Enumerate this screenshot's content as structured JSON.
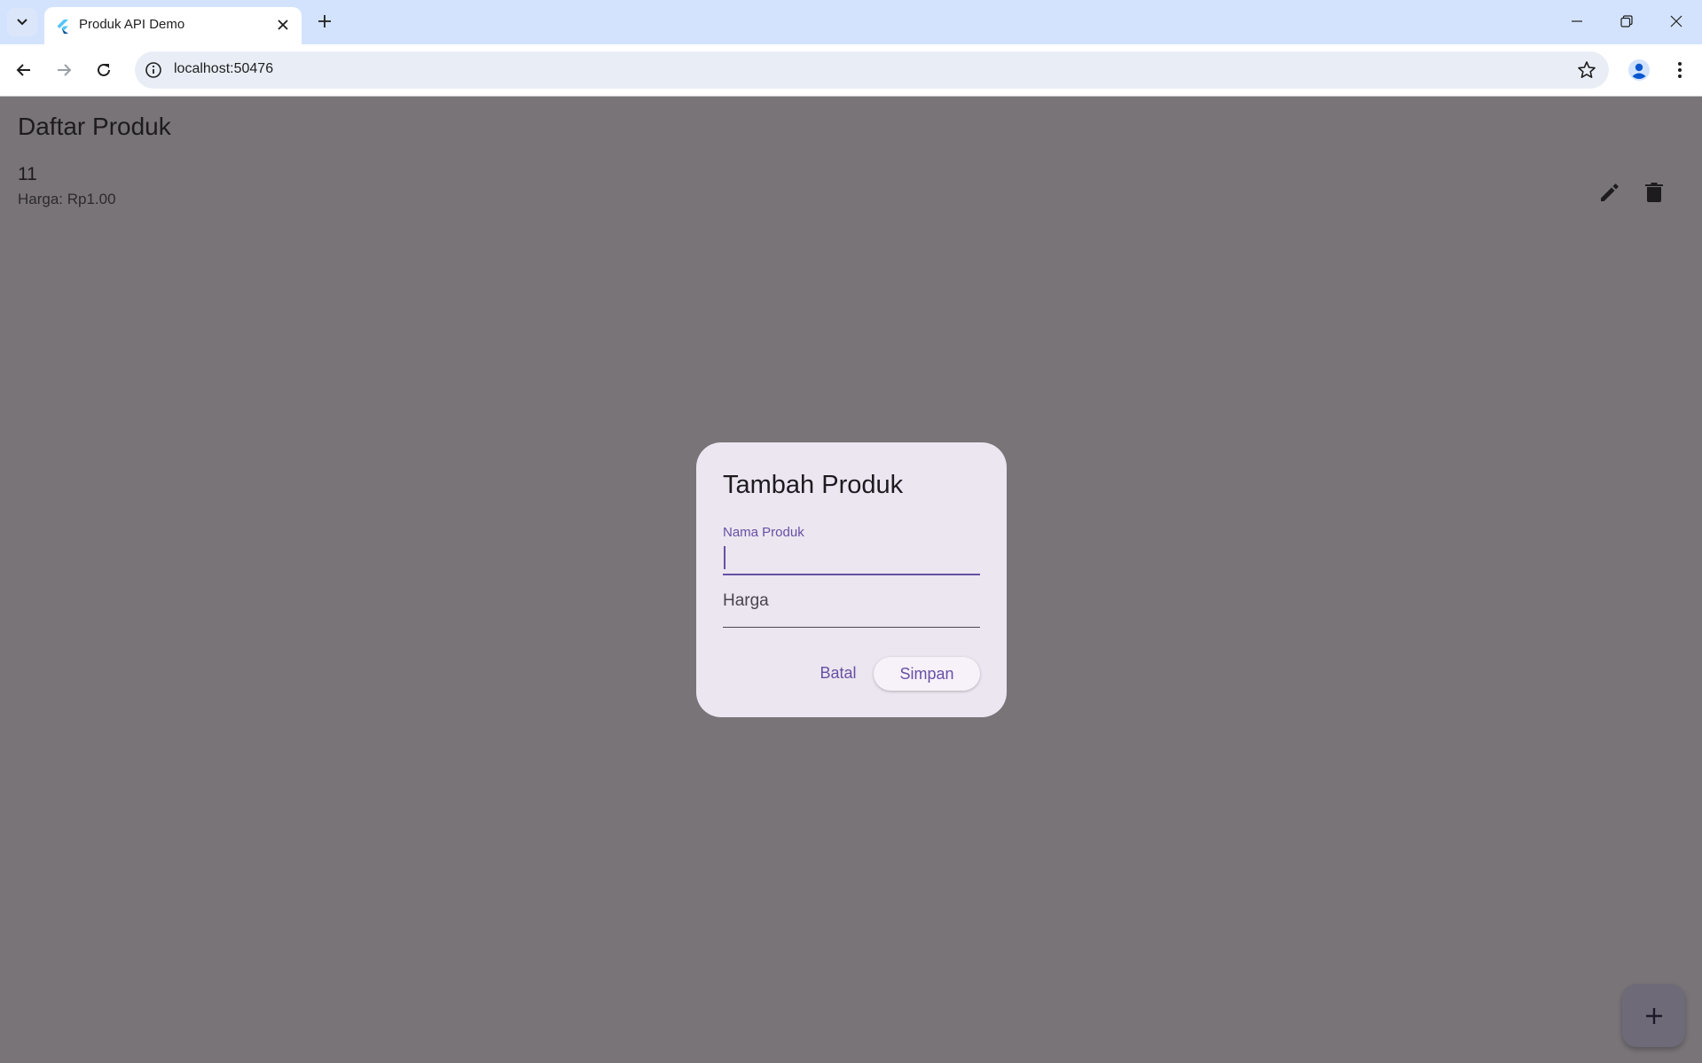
{
  "browser": {
    "tab_title": "Produk API Demo",
    "url": "localhost:50476"
  },
  "app": {
    "title": "Daftar Produk",
    "products": [
      {
        "name": "11",
        "price_label": "Harga: Rp1.00"
      }
    ]
  },
  "dialog": {
    "title": "Tambah Produk",
    "name_field": {
      "label": "Nama Produk",
      "value": ""
    },
    "price_field": {
      "label": "Harga",
      "value": ""
    },
    "cancel_label": "Batal",
    "save_label": "Simpan"
  },
  "colors": {
    "primary": "#6750a4",
    "scrim": "#787478",
    "dialog_bg": "#ece6f0"
  }
}
